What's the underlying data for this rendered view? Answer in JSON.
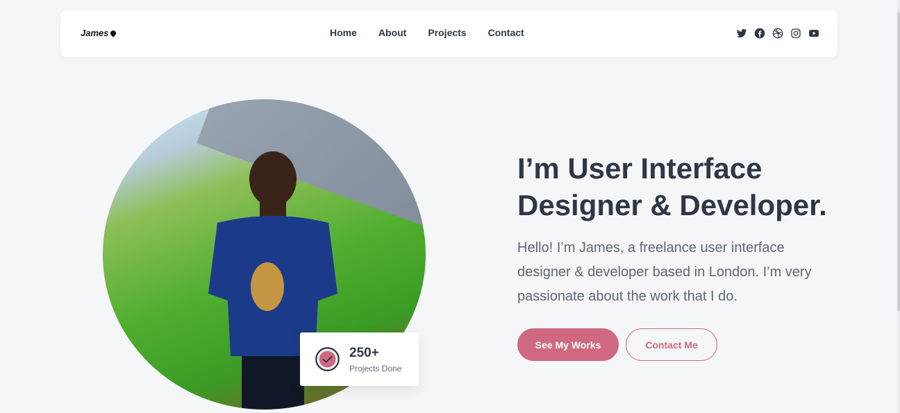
{
  "navbar": {
    "brand": "James",
    "links": [
      "Home",
      "About",
      "Projects",
      "Contact"
    ],
    "socials": [
      "twitter-icon",
      "facebook-icon",
      "dribbble-icon",
      "instagram-icon",
      "youtube-icon"
    ]
  },
  "hero": {
    "title": "I’m User Interface Designer & Developer.",
    "description": "Hello! I’m James, a freelance user interface designer & developer based in London. I’m very passionate about the work that I do.",
    "primary_button": "See My Works",
    "secondary_button": "Contact Me"
  },
  "stat_card": {
    "value": "250+",
    "label": "Projects Done"
  },
  "colors": {
    "accent": "#d0697f",
    "text": "#2f3747",
    "muted": "#5d6675",
    "background": "#f5f6f8"
  }
}
